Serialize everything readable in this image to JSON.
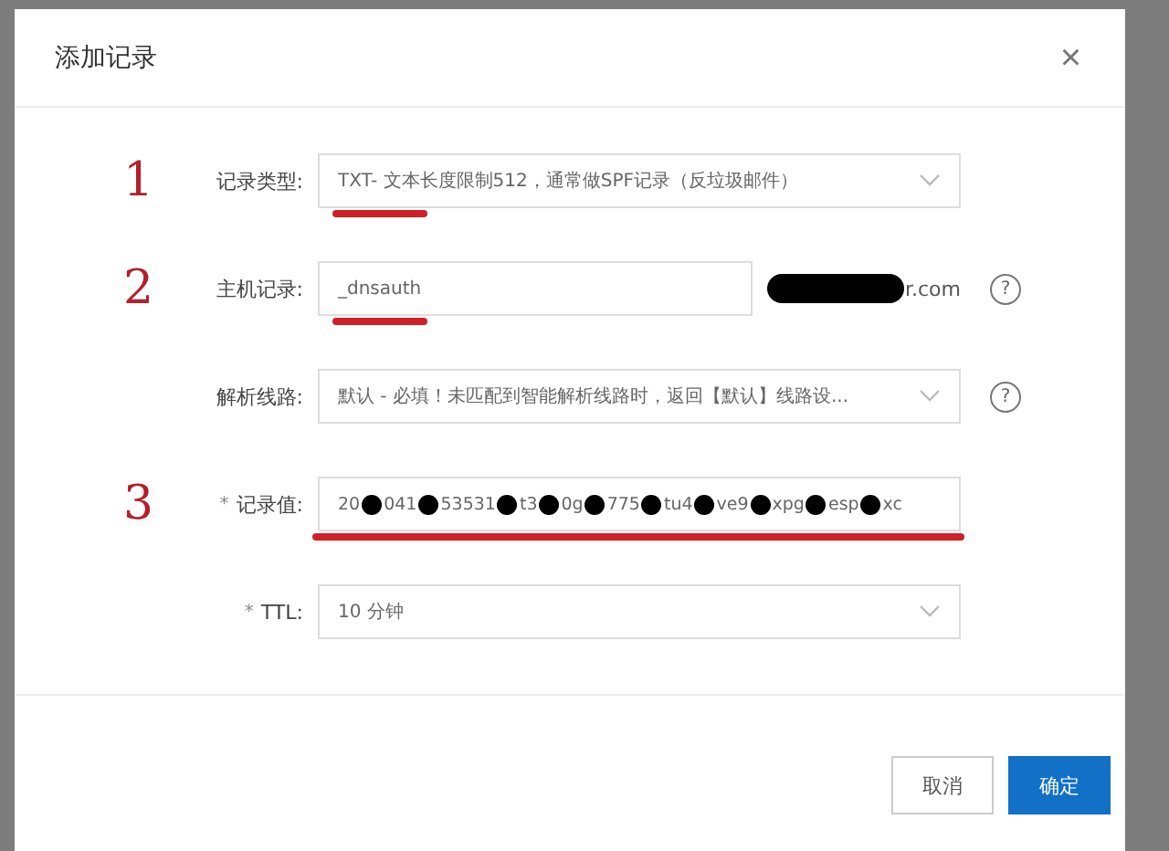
{
  "dialog": {
    "title": "添加记录",
    "close": "×"
  },
  "fields": [
    {
      "kind": "select",
      "label": "记录类型:",
      "value": "TXT- 文本长度限制512，通常做SPF记录（反垃圾邮件）",
      "annotation": "1",
      "underlined": true
    },
    {
      "kind": "input",
      "label": "主机记录:",
      "value": "_dnsauth",
      "suffix": "r.com",
      "redacted_suffix": true,
      "help": "?",
      "annotation": "2",
      "underlined": true
    },
    {
      "kind": "select",
      "label": "解析线路:",
      "value": "默认 - 必填！未匹配到智能解析线路时，返回【默认】线路设...",
      "help": "?"
    },
    {
      "kind": "redacted",
      "label": "记录值:",
      "required_mark": "*",
      "value_parts": [
        "20",
        "041",
        "53531",
        "t3",
        "0g",
        "775",
        "tu4",
        "ve9",
        "xpg",
        "esp",
        "xc"
      ],
      "annotation": "3",
      "underlined": true
    },
    {
      "kind": "select",
      "label": "TTL:",
      "required_mark": "*",
      "value": "10 分钟"
    }
  ],
  "buttons": [
    {
      "label": "取消",
      "primary": false
    },
    {
      "label": "确定",
      "primary": true
    }
  ]
}
